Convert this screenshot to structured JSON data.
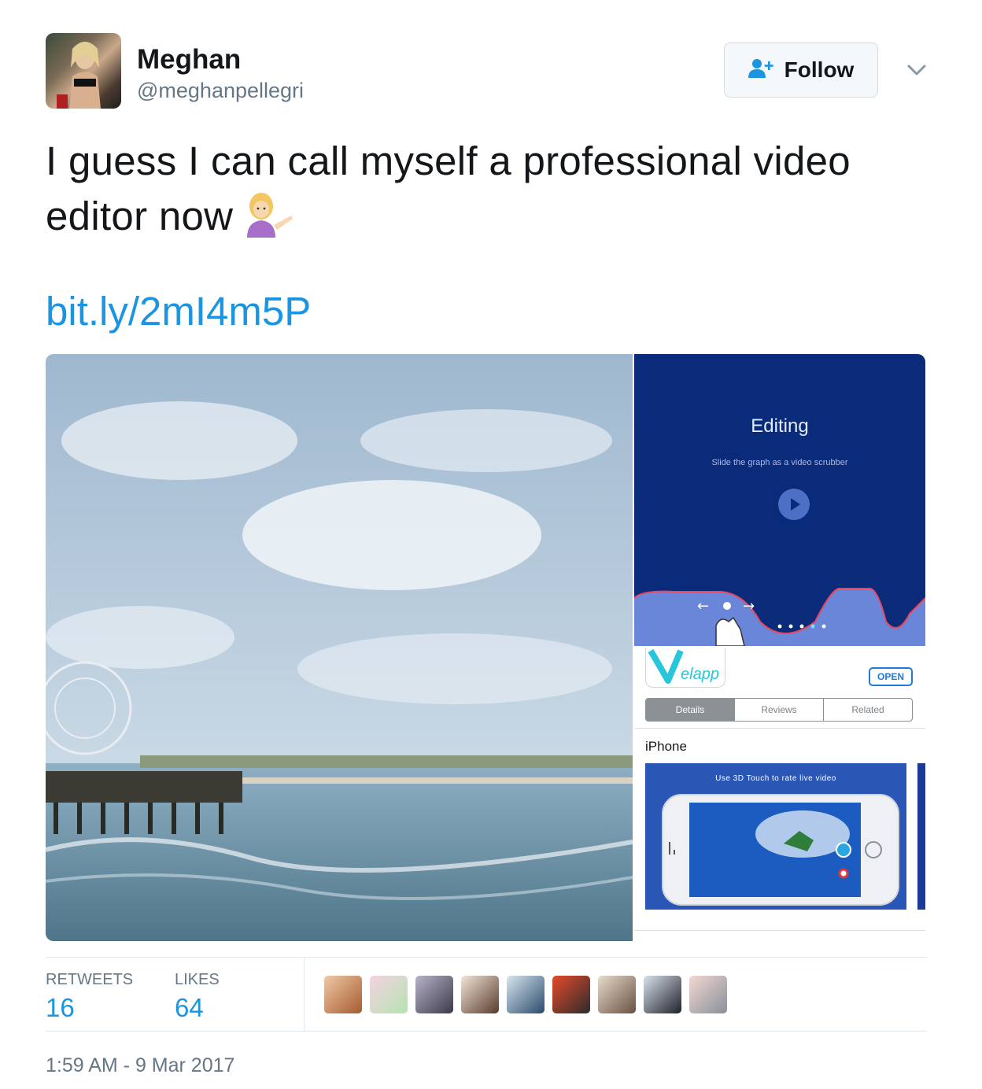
{
  "user": {
    "display_name": "Meghan",
    "handle": "@meghanpellegri",
    "avatar_icon": "profile-photo"
  },
  "follow_button": {
    "label": "Follow",
    "icon": "add-user-icon"
  },
  "menu_caret_icon": "chevron-down-icon",
  "tweet": {
    "text": "I guess I can call myself a professional video editor now",
    "emoji": "woman-tipping-hand-emoji",
    "link": "bit.ly/2mI4m5P"
  },
  "media": {
    "app_screen": {
      "title": "Editing",
      "subtitle": "Slide the graph as a video scrubber"
    },
    "app_store": {
      "app_name": "elapp",
      "open_label": "OPEN",
      "tabs": [
        "Details",
        "Reviews",
        "Related"
      ],
      "device_label": "iPhone",
      "screenshot_caption": "Use 3D Touch to rate live video"
    }
  },
  "stats": {
    "retweets_label": "RETWEETS",
    "retweets_value": "16",
    "likes_label": "LIKES",
    "likes_value": "64"
  },
  "timestamp": "1:59 AM - 9 Mar 2017",
  "colors": {
    "link": "#1b95e0",
    "muted": "#657786",
    "text": "#14171a"
  }
}
